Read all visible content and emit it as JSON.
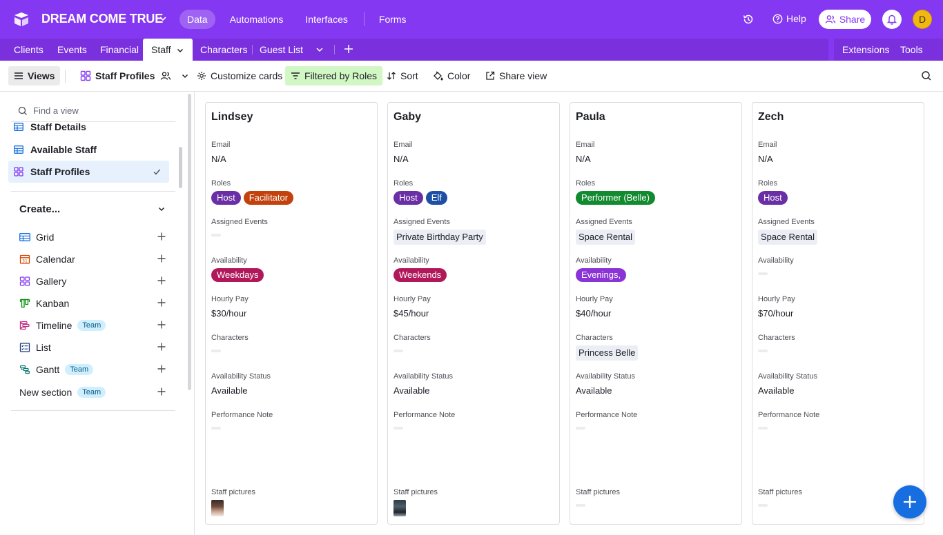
{
  "app": {
    "base_name": "DREAM COME TRUE",
    "nav": [
      "Data",
      "Automations",
      "Interfaces",
      "Forms"
    ],
    "active_nav": "Data",
    "help_label": "Help",
    "share_label": "Share",
    "avatar_initial": "D",
    "accent": "#8538f1"
  },
  "tables": {
    "tabs": [
      "Clients",
      "Events",
      "Financial",
      "Staff",
      "Characters",
      "Guest List"
    ],
    "active": "Staff",
    "extensions_label": "Extensions",
    "tools_label": "Tools"
  },
  "viewbar": {
    "views_label": "Views",
    "current_view": "Staff Profiles",
    "customize_label": "Customize cards",
    "filter_label": "Filtered by Roles",
    "sort_label": "Sort",
    "color_label": "Color",
    "share_view_label": "Share view"
  },
  "sidebar": {
    "find_placeholder": "Find a view",
    "views": [
      {
        "label": "Staff Details",
        "icon": "grid-icon"
      },
      {
        "label": "Available Staff",
        "icon": "grid-icon"
      },
      {
        "label": "Staff Profiles",
        "icon": "gallery-icon",
        "active": true
      }
    ],
    "create_title": "Create...",
    "create_items": [
      {
        "label": "Grid",
        "icon": "grid-icon",
        "team": false
      },
      {
        "label": "Calendar",
        "icon": "calendar-icon",
        "team": false
      },
      {
        "label": "Gallery",
        "icon": "gallery-icon",
        "team": false
      },
      {
        "label": "Kanban",
        "icon": "kanban-icon",
        "team": false
      },
      {
        "label": "Timeline",
        "icon": "timeline-icon",
        "team": true
      },
      {
        "label": "List",
        "icon": "list-icon",
        "team": false
      },
      {
        "label": "Gantt",
        "icon": "gantt-icon",
        "team": true
      }
    ],
    "new_section_label": "New section",
    "team_label": "Team"
  },
  "labels": {
    "email": "Email",
    "roles": "Roles",
    "assigned_events": "Assigned Events",
    "availability": "Availability",
    "hourly_pay": "Hourly Pay",
    "characters": "Characters",
    "availability_status": "Availability Status",
    "performance_note": "Performance Note",
    "staff_pictures": "Staff pictures"
  },
  "cards": [
    {
      "name": "Lindsey",
      "email": "N/A",
      "roles": [
        {
          "label": "Host",
          "color": "#6b2fa5"
        },
        {
          "label": "Facilitator",
          "color": "#c2410c"
        }
      ],
      "assigned_events": [],
      "availability": [
        {
          "label": "Weekdays",
          "color": "#b0185a"
        }
      ],
      "hourly_pay": "$30/hour",
      "characters": [],
      "availability_status": "Available",
      "performance_note": "",
      "has_picture": true
    },
    {
      "name": "Gaby",
      "email": "N/A",
      "roles": [
        {
          "label": "Host",
          "color": "#6b2fa5"
        },
        {
          "label": "Elf",
          "color": "#1d4fa5"
        }
      ],
      "assigned_events": [
        "Private Birthday Party"
      ],
      "availability": [
        {
          "label": "Weekends",
          "color": "#b0185a"
        }
      ],
      "hourly_pay": "$45/hour",
      "characters": [],
      "availability_status": "Available",
      "performance_note": "",
      "has_picture": true
    },
    {
      "name": "Paula",
      "email": "N/A",
      "roles": [
        {
          "label": "Performer (Belle)",
          "color": "#128a2f"
        }
      ],
      "assigned_events": [
        "Space Rental"
      ],
      "availability": [
        {
          "label": "Evenings,",
          "color": "#8a33d6"
        }
      ],
      "hourly_pay": "$40/hour",
      "characters": [
        "Princess Belle"
      ],
      "availability_status": "Available",
      "performance_note": "",
      "has_picture": false
    },
    {
      "name": "Zech",
      "email": "N/A",
      "roles": [
        {
          "label": "Host",
          "color": "#6b2fa5"
        }
      ],
      "assigned_events": [
        "Space Rental"
      ],
      "availability": [],
      "hourly_pay": "$70/hour",
      "characters": [],
      "availability_status": "Available",
      "performance_note": "",
      "has_picture": false
    }
  ]
}
